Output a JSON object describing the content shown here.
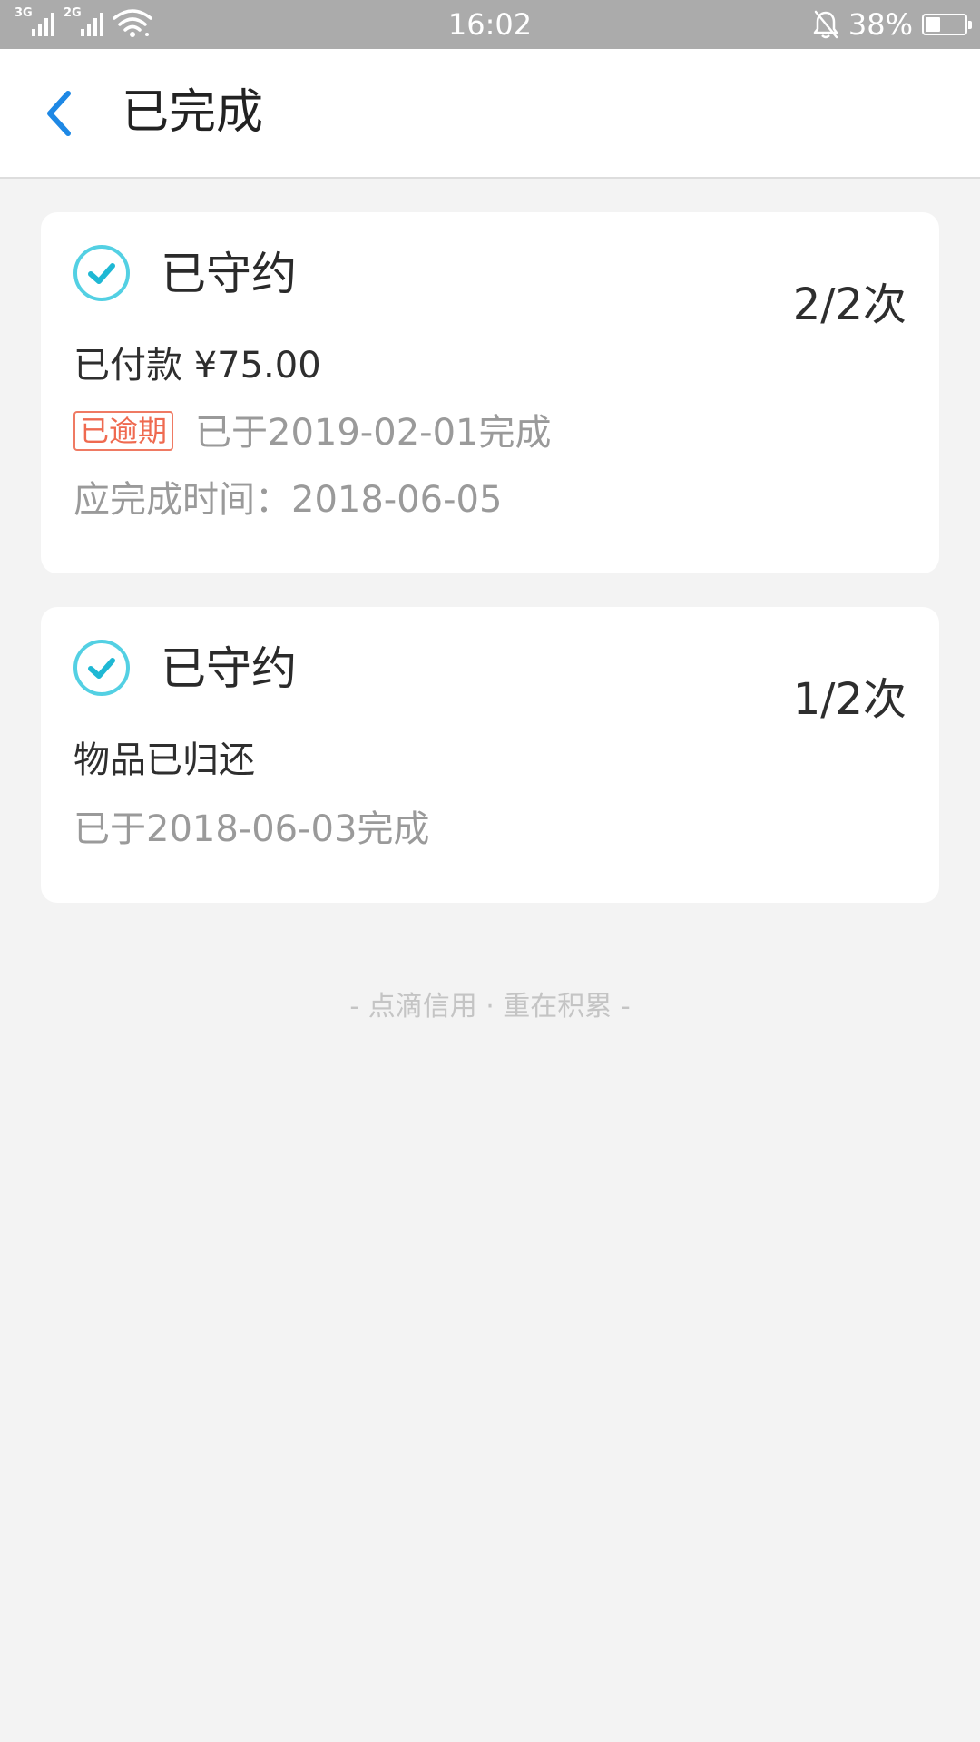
{
  "status_bar": {
    "network_1": "3G",
    "network_2": "2G",
    "time": "16:02",
    "battery_percent": "38%",
    "battery_level": 0.38,
    "icons": [
      "signal-3g-icon",
      "signal-2g-icon",
      "wifi-icon",
      "bell-off-icon",
      "battery-icon"
    ]
  },
  "header": {
    "back_icon": "chevron-left-icon",
    "title": "已完成"
  },
  "cards": [
    {
      "status": "已守约",
      "count": "2/2次",
      "detail": "已付款 ¥75.00",
      "badge": "已逾期",
      "completed_text": "已于2019-02-01完成",
      "due_text": "应完成时间：2018-06-05"
    },
    {
      "status": "已守约",
      "count": "1/2次",
      "detail": "物品已归还",
      "completed_text": "已于2018-06-03完成"
    }
  ],
  "footer": {
    "slogan": "- 点滴信用 · 重在积累 -"
  },
  "colors": {
    "accent_blue": "#1e88e5",
    "check_cyan": "#35c8de",
    "overdue_red": "#ef6a50",
    "status_bar": "#ababab",
    "background": "#f3f3f3"
  }
}
